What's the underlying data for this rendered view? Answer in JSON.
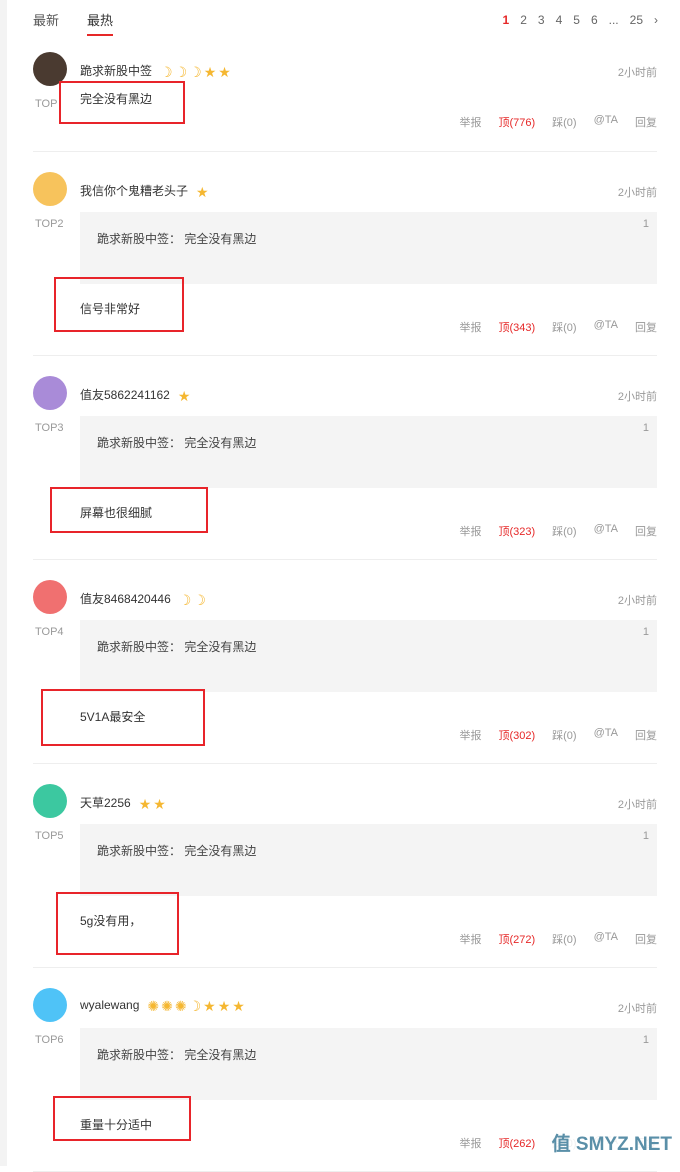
{
  "tabs": [
    {
      "label": "最新",
      "active": false
    },
    {
      "label": "最热",
      "active": true
    }
  ],
  "pagination": {
    "pages": [
      "1",
      "2",
      "3",
      "4",
      "5",
      "6",
      "...",
      "25"
    ],
    "current": "1",
    "next": "›"
  },
  "colors": {
    "accent": "#e62828",
    "badge": "#f5b731"
  },
  "comments": [
    {
      "rank": "TOP",
      "user": "跪求新股中签",
      "badges": [
        "moon",
        "moon",
        "moon",
        "star",
        "star"
      ],
      "time": "2小时前",
      "quote": null,
      "text": "完全没有黑边",
      "report": "举报",
      "up": "顶(776)",
      "down": "踩(0)",
      "at": "@TA",
      "reply": "回复",
      "avatar_color": "#4a3a30"
    },
    {
      "rank": "TOP2",
      "user": "我信你个鬼糟老头子",
      "badges": [
        "star"
      ],
      "time": "2小时前",
      "quote": "跪求新股中签： 完全没有黑边",
      "quote_num": "1",
      "text": "信号非常好",
      "report": "举报",
      "up": "顶(343)",
      "down": "踩(0)",
      "at": "@TA",
      "reply": "回复",
      "avatar_color": "#f7c35c"
    },
    {
      "rank": "TOP3",
      "user": "值友5862241162",
      "badges": [
        "star"
      ],
      "time": "2小时前",
      "quote": "跪求新股中签： 完全没有黑边",
      "quote_num": "1",
      "text": "屏幕也很细腻",
      "report": "举报",
      "up": "顶(323)",
      "down": "踩(0)",
      "at": "@TA",
      "reply": "回复",
      "avatar_color": "#a98bd8"
    },
    {
      "rank": "TOP4",
      "user": "值友8468420446",
      "badges": [
        "moon",
        "moon"
      ],
      "time": "2小时前",
      "quote": "跪求新股中签： 完全没有黑边",
      "quote_num": "1",
      "text": "5V1A最安全",
      "report": "举报",
      "up": "顶(302)",
      "down": "踩(0)",
      "at": "@TA",
      "reply": "回复",
      "avatar_color": "#f07070"
    },
    {
      "rank": "TOP5",
      "user": "天草2256",
      "badges": [
        "star",
        "star"
      ],
      "time": "2小时前",
      "quote": "跪求新股中签： 完全没有黑边",
      "quote_num": "1",
      "text": "5g没有用，",
      "report": "举报",
      "up": "顶(272)",
      "down": "踩(0)",
      "at": "@TA",
      "reply": "回复",
      "avatar_color": "#3cc8a0"
    },
    {
      "rank": "TOP6",
      "user": "wyalewang",
      "badges": [
        "sun",
        "sun",
        "sun",
        "moon",
        "star",
        "star",
        "star"
      ],
      "time": "2小时前",
      "quote": "跪求新股中签： 完全没有黑边",
      "quote_num": "1",
      "text": "重量十分适中",
      "report": "举报",
      "up": "顶(262)",
      "down": "踩(0)",
      "at": "@TA",
      "reply": "回复",
      "avatar_color": "#4fc3f7"
    }
  ],
  "watermark": "值 SMYZ.NET"
}
